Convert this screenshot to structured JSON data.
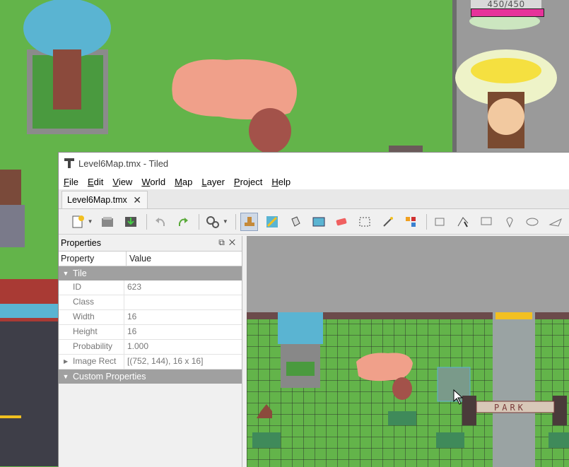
{
  "game": {
    "counter": "450/450"
  },
  "window": {
    "title": "Level6Map.tmx - Tiled"
  },
  "menu": [
    "File",
    "Edit",
    "View",
    "World",
    "Map",
    "Layer",
    "Project",
    "Help"
  ],
  "tab": {
    "label": "Level6Map.tmx",
    "close": "✕"
  },
  "properties": {
    "panel_title": "Properties",
    "col_property": "Property",
    "col_value": "Value",
    "group_tile": "Tile",
    "group_custom": "Custom Properties",
    "rows": [
      {
        "name": "ID",
        "value": "623"
      },
      {
        "name": "Class",
        "value": ""
      },
      {
        "name": "Width",
        "value": "16"
      },
      {
        "name": "Height",
        "value": "16"
      },
      {
        "name": "Probability",
        "value": "1.000"
      },
      {
        "name": "Image Rect",
        "value": "[(752, 144), 16 x 16]"
      }
    ]
  },
  "map": {
    "sign_text": "PARK"
  }
}
